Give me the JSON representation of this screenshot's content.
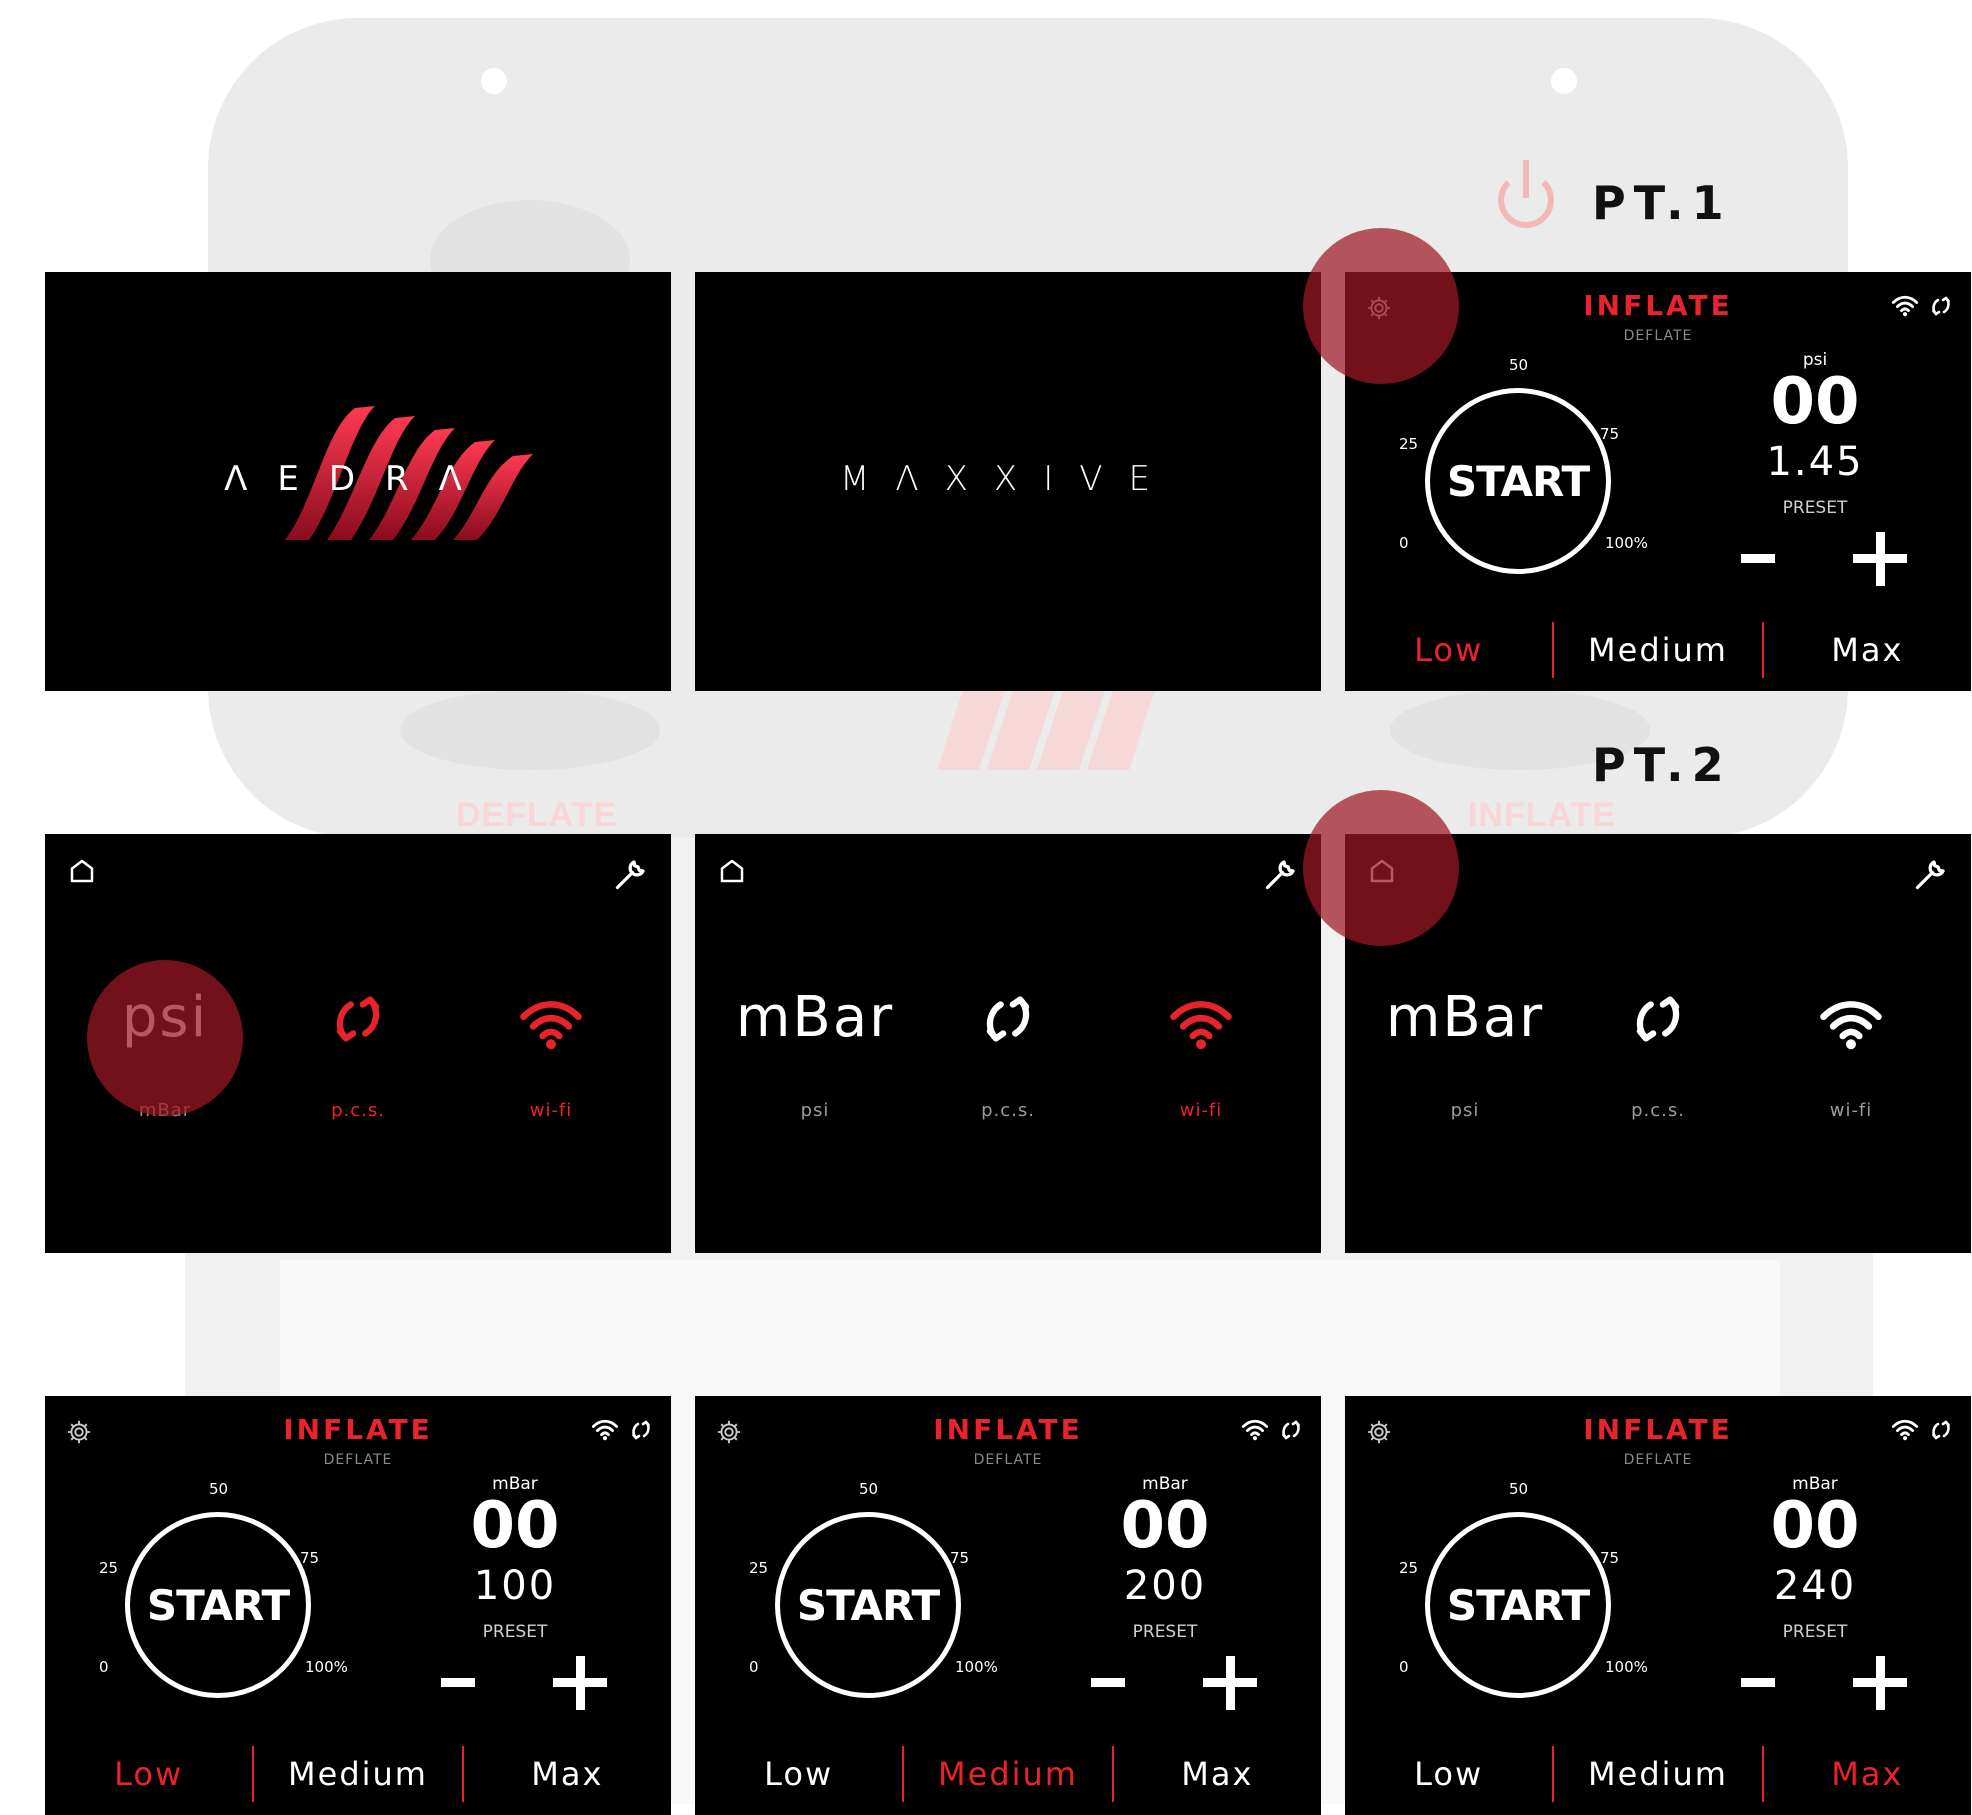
{
  "headings": {
    "pt1": "PT.1",
    "pt2": "PT.2"
  },
  "background": {
    "deflate_label": "DEFLATE",
    "inflate_label": "INFLATE"
  },
  "splash": {
    "aedra": "ΛEDRΛ",
    "maxxive": "MΛXXIVE"
  },
  "colors": {
    "accent": "#e9232b",
    "screen_bg": "#000000",
    "highlight": "#a01826"
  },
  "inflate_screens": [
    {
      "title": "INFLATE",
      "subtitle": "DEFLATE",
      "unit": "psi",
      "current": "00",
      "preset": "1.45",
      "preset_label": "PRESET",
      "ticks": [
        "0",
        "25",
        "50",
        "75",
        "100%"
      ],
      "start": "START",
      "modes": [
        "Low",
        "Medium",
        "Max"
      ],
      "active_mode": 0
    },
    {
      "title": "INFLATE",
      "subtitle": "DEFLATE",
      "unit": "mBar",
      "current": "00",
      "preset": "100",
      "preset_label": "PRESET",
      "ticks": [
        "0",
        "25",
        "50",
        "75",
        "100%"
      ],
      "start": "START",
      "modes": [
        "Low",
        "Medium",
        "Max"
      ],
      "active_mode": 0
    },
    {
      "title": "INFLATE",
      "subtitle": "DEFLATE",
      "unit": "mBar",
      "current": "00",
      "preset": "200",
      "preset_label": "PRESET",
      "ticks": [
        "0",
        "25",
        "50",
        "75",
        "100%"
      ],
      "start": "START",
      "modes": [
        "Low",
        "Medium",
        "Max"
      ],
      "active_mode": 1
    },
    {
      "title": "INFLATE",
      "subtitle": "DEFLATE",
      "unit": "mBar",
      "current": "00",
      "preset": "240",
      "preset_label": "PRESET",
      "ticks": [
        "0",
        "25",
        "50",
        "75",
        "100%"
      ],
      "start": "START",
      "modes": [
        "Low",
        "Medium",
        "Max"
      ],
      "active_mode": 2
    }
  ],
  "settings_screens": [
    {
      "unit_big": "psi",
      "unit_small": "mBar",
      "pcs": "p.c.s.",
      "wifi": "wi-fi",
      "pcs_active": true,
      "wifi_active": true
    },
    {
      "unit_big": "mBar",
      "unit_small": "psi",
      "pcs": "p.c.s.",
      "wifi": "wi-fi",
      "pcs_active": false,
      "wifi_active": true
    },
    {
      "unit_big": "mBar",
      "unit_small": "psi",
      "pcs": "p.c.s.",
      "wifi": "wi-fi",
      "pcs_active": false,
      "wifi_active": false
    }
  ],
  "icons": [
    "gear-icon",
    "wifi-icon",
    "sync-icon",
    "home-icon",
    "wrench-icon",
    "power-icon"
  ]
}
